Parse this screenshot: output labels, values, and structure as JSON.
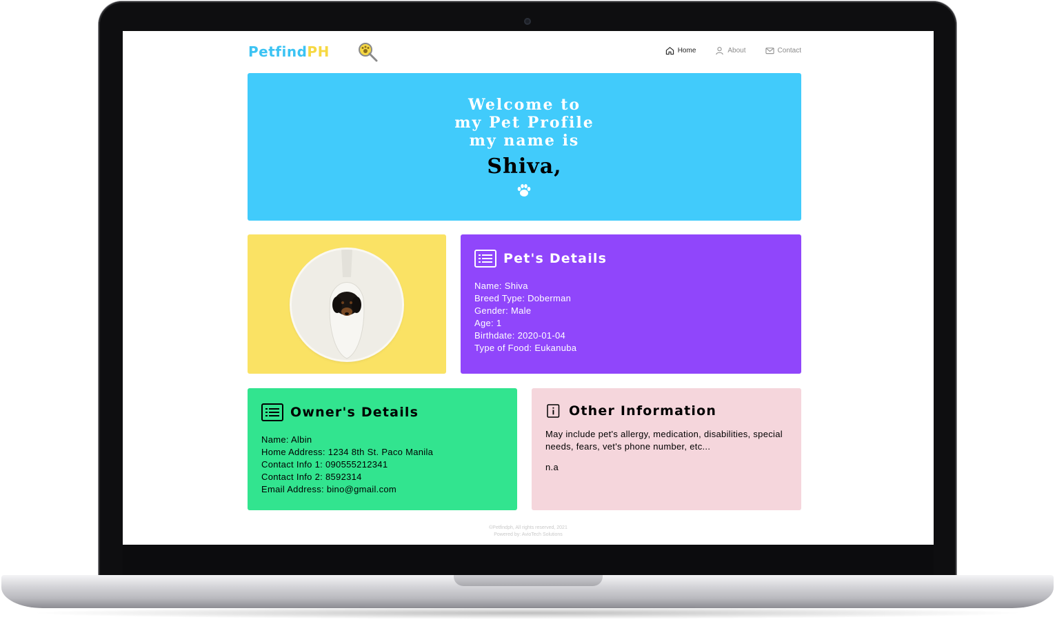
{
  "brand": {
    "name_part1": "Petfind",
    "name_part2": "PH"
  },
  "nav": {
    "items": [
      {
        "label": "Home",
        "icon": "home-icon",
        "active": true
      },
      {
        "label": "About",
        "icon": "user-icon",
        "active": false
      },
      {
        "label": "Contact",
        "icon": "mail-icon",
        "active": false
      }
    ]
  },
  "hero": {
    "line1": "Welcome to",
    "line2": "my Pet Profile",
    "line3": "my name is",
    "pet_name": "Shiva,",
    "icon": "paw-icon"
  },
  "pet_details": {
    "heading": "Pet's Details",
    "rows": [
      {
        "label": "Name:",
        "value": "Shiva"
      },
      {
        "label": "Breed Type:",
        "value": "Doberman"
      },
      {
        "label": "Gender:",
        "value": "Male"
      },
      {
        "label": "Age:",
        "value": "1"
      },
      {
        "label": "Birthdate:",
        "value": "2020-01-04"
      },
      {
        "label": "Type of Food:",
        "value": "Eukanuba"
      }
    ]
  },
  "owner_details": {
    "heading": "Owner's Details",
    "rows": [
      {
        "label": "Name:",
        "value": "Albin"
      },
      {
        "label": "Home Address:",
        "value": "1234 8th St. Paco Manila"
      },
      {
        "label": "Contact Info 1:",
        "value": "090555212341"
      },
      {
        "label": "Contact Info 2:",
        "value": "8592314"
      },
      {
        "label": "Email Address:",
        "value": "bino@gmail.com"
      }
    ]
  },
  "other_info": {
    "heading": "Other Information",
    "description": "May include pet's allergy, medication, disabilities, special needs, fears, vet's phone number, etc...",
    "value": "n.a"
  },
  "footer": {
    "line1": "©Petfindph, All rights reserved, 2021",
    "line2": "Powered by: AvioTech Solutions"
  },
  "colors": {
    "hero": "#41cbfb",
    "photo_card": "#fae264",
    "pet_card": "#9046fb",
    "owner_card": "#32e48f",
    "other_card": "#f5d6dc"
  }
}
